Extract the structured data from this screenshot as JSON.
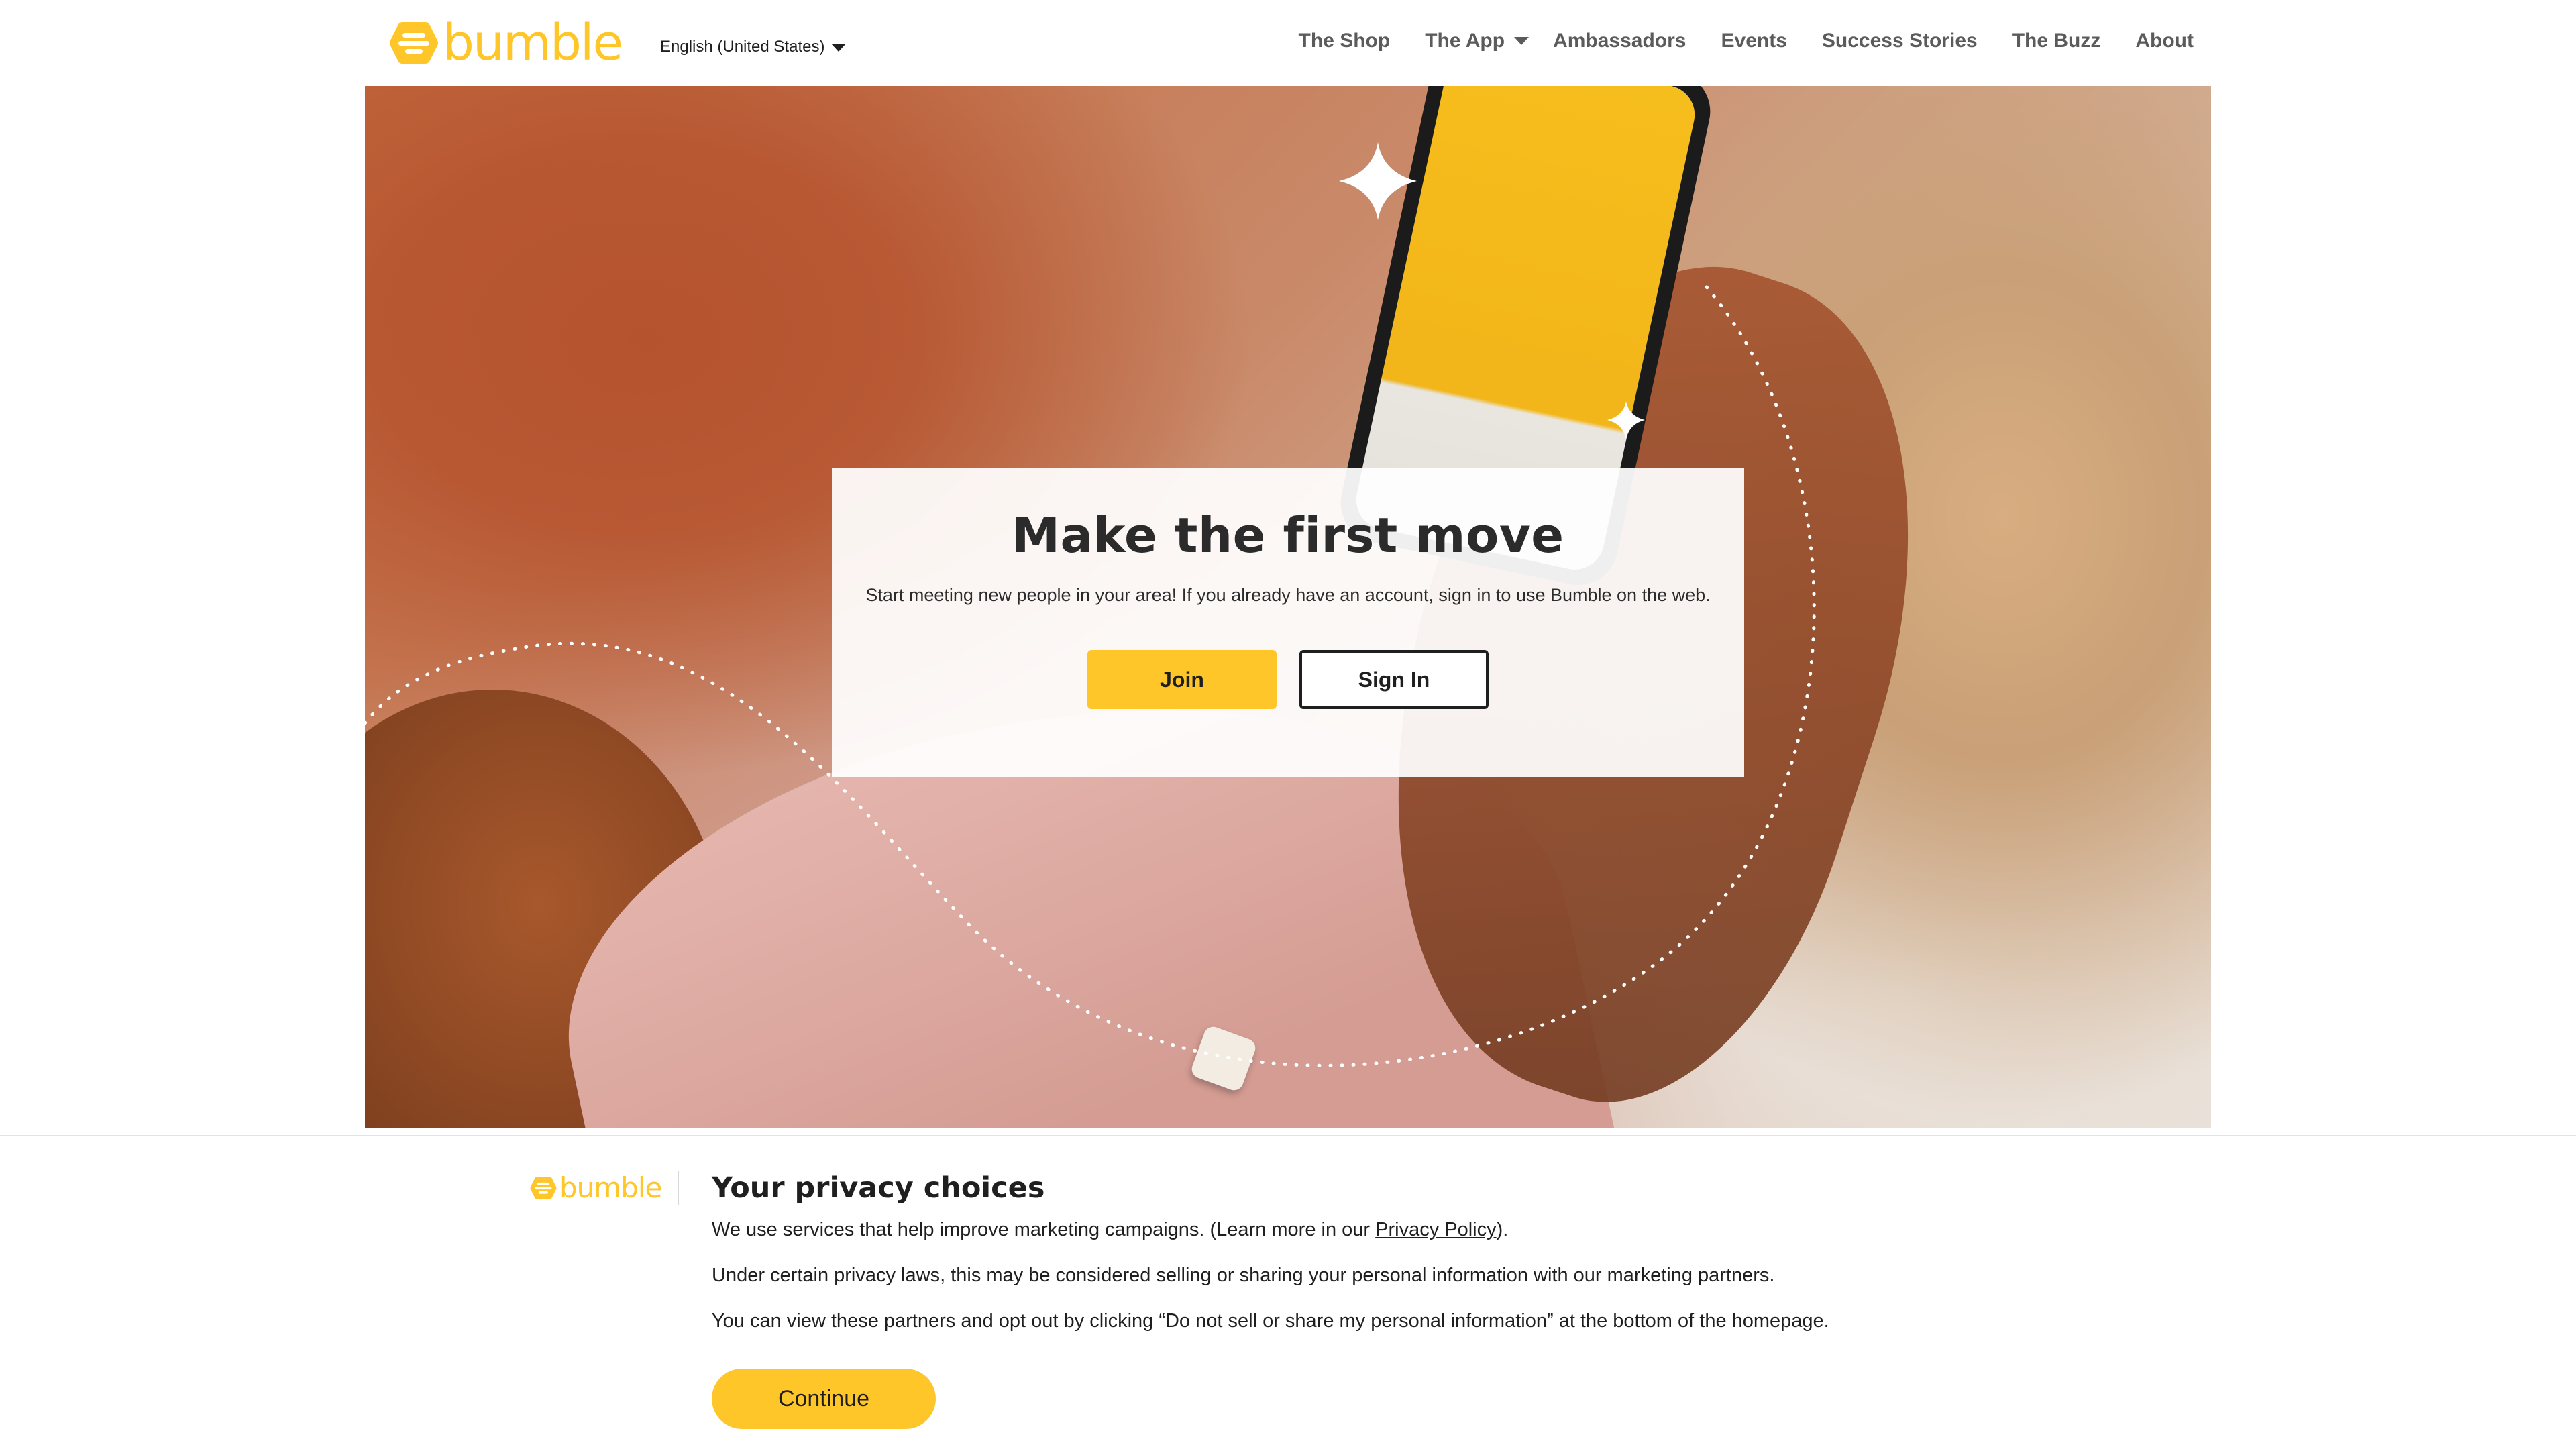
{
  "brand": {
    "name": "bumble",
    "accent": "#ffc629"
  },
  "header": {
    "language": "English (United States)",
    "nav": [
      {
        "label": "The Shop",
        "dropdown": false
      },
      {
        "label": "The App",
        "dropdown": true
      },
      {
        "label": "Ambassadors",
        "dropdown": false
      },
      {
        "label": "Events",
        "dropdown": false
      },
      {
        "label": "Success Stories",
        "dropdown": false
      },
      {
        "label": "The Buzz",
        "dropdown": false
      },
      {
        "label": "About",
        "dropdown": false
      }
    ]
  },
  "hero": {
    "title": "Make the first move",
    "text": "Start meeting new people in your area! If you already have an account, sign in to use Bumble on the web.",
    "join_label": "Join",
    "signin_label": "Sign In"
  },
  "privacy": {
    "title": "Your privacy choices",
    "line1_before": "We use services that help improve marketing campaigns. (Learn more in our ",
    "line1_link": "Privacy Policy",
    "line1_after": ").",
    "line2": "Under certain privacy laws, this may be considered selling or sharing your personal information with our marketing partners.",
    "line3": "You can view these partners and opt out by clicking “Do not sell or share my personal information” at the bottom of the homepage.",
    "continue_label": "Continue"
  }
}
